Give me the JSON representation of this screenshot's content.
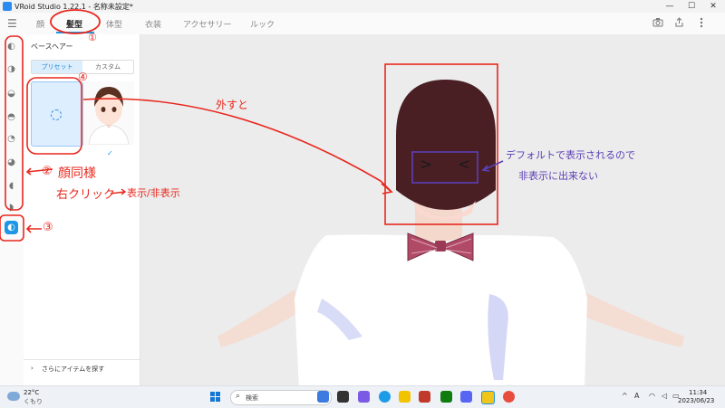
{
  "window": {
    "title": "VRoid Studio 1.22.1 - 名称未設定*",
    "controls": {
      "minimize": "—",
      "maximize": "☐",
      "close": "✕"
    }
  },
  "appbar": {
    "menu_icon": "hamburger-icon",
    "tabs": [
      {
        "label": "顔",
        "active": false
      },
      {
        "label": "髪型",
        "active": true
      },
      {
        "label": "体型",
        "active": false
      },
      {
        "label": "衣装",
        "active": false
      },
      {
        "label": "アクセサリー",
        "active": false
      },
      {
        "label": "ルック",
        "active": false
      }
    ],
    "right_icons": [
      "camera-icon",
      "share-icon",
      "more-vert-icon"
    ]
  },
  "leftbar": {
    "items": [
      "front-hair-icon",
      "back-hair-icon",
      "side-hair-icon",
      "ahoge-icon",
      "tail-icon",
      "ear-hair-icon",
      "strand-icon",
      "braid-icon",
      "base-hair-icon"
    ],
    "active_index": 8
  },
  "panel": {
    "title": "ベースヘアー",
    "seg_preset": "プリセット",
    "seg_custom": "カスタム",
    "selected_check": "✓",
    "more_label": "さらにアイテムを探す",
    "more_chevron": "›"
  },
  "annotations": {
    "n1": "①",
    "n2": "②",
    "n3": "③",
    "n4": "④",
    "face_same": "顔同様",
    "right_click": "右クリック",
    "toggle_show": "表示/非表示",
    "remove": "外すと",
    "blue_line1": "デフォルトで表示されるので",
    "blue_line2": "非表示に出来ない",
    "eyes_left": ">",
    "eyes_right": "<",
    "colors": {
      "red": "#e8281e",
      "blue": "#5b3fb6"
    }
  },
  "taskbar": {
    "weather_temp": "22°C",
    "weather_desc": "くもり",
    "search_placeholder": "検索",
    "search_icon": "search-icon",
    "tray_caret": "^",
    "ime": "A",
    "time": "11:34",
    "date": "2023/06/23"
  },
  "accent": "#1e96e6"
}
